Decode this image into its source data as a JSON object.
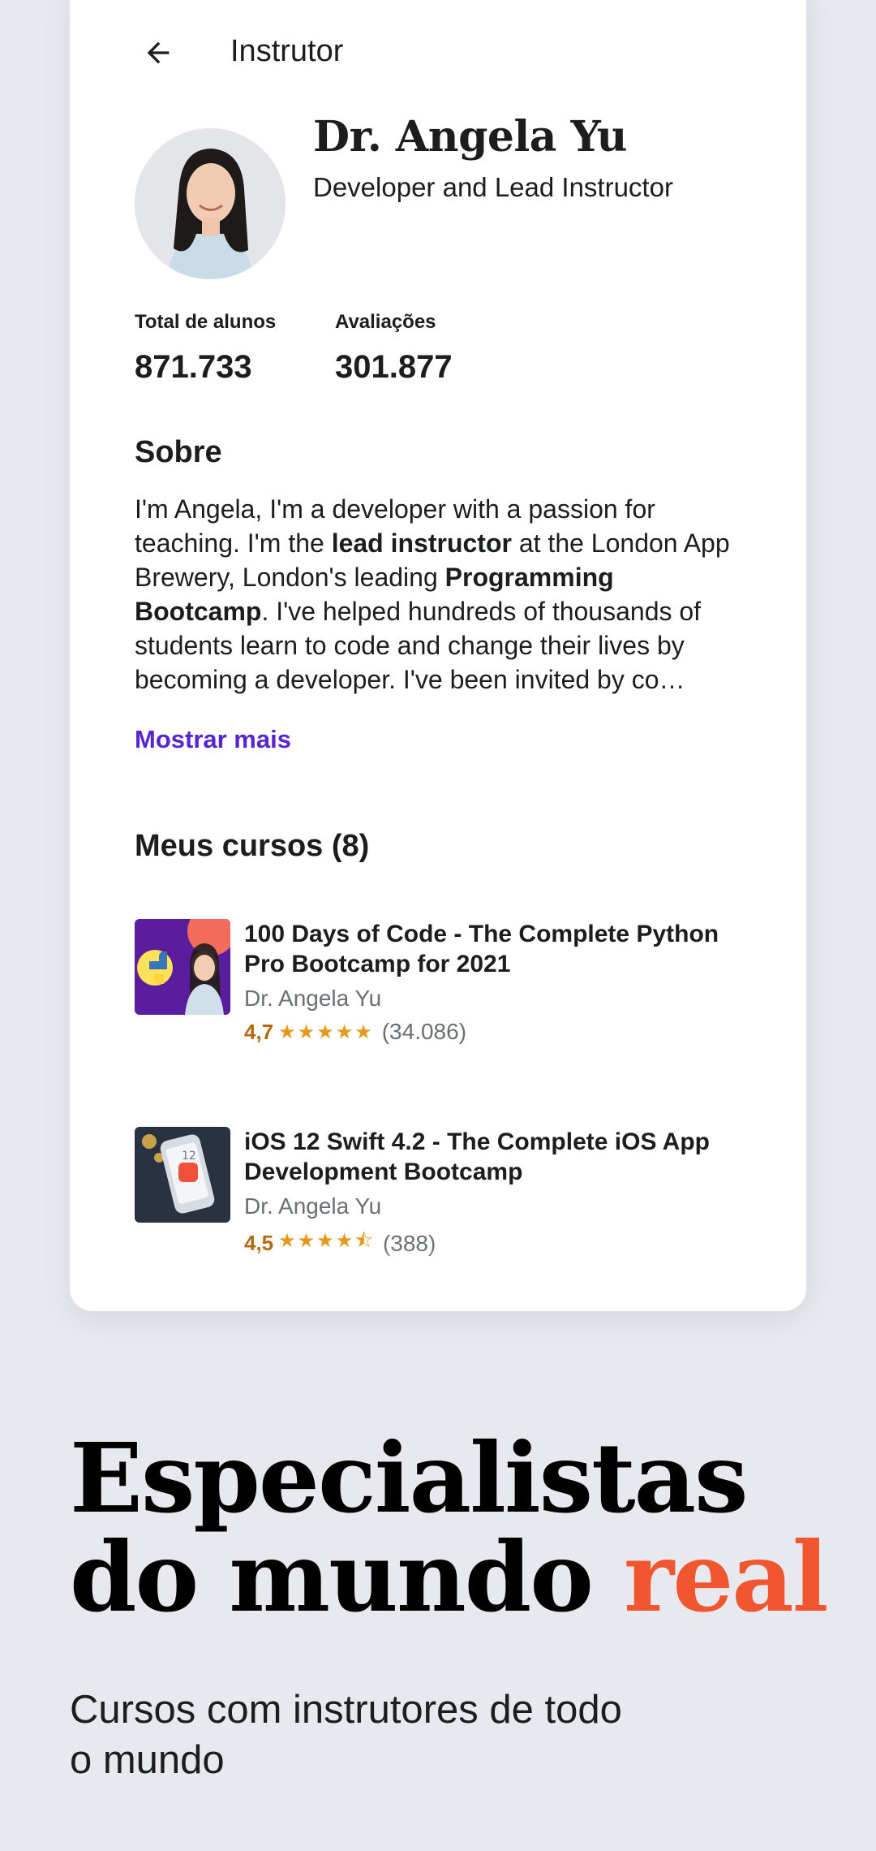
{
  "header": {
    "title": "Instrutor"
  },
  "instructor": {
    "name": "Dr. Angela Yu",
    "job_title": "Developer and Lead Instructor"
  },
  "stats": [
    {
      "label": "Total de alunos",
      "value": "871.733"
    },
    {
      "label": "Avaliações",
      "value": "301.877"
    }
  ],
  "about": {
    "title": "Sobre",
    "p1": "I'm Angela, I'm a developer with a passion for teaching. I'm the ",
    "b1": "lead instructor",
    "p2": " at the London App Brewery, London's leading ",
    "b2": "Programming Bootcamp",
    "p3": ". I've helped hundreds of thousands of students learn to code and change their lives by becoming a developer. I've been invited by co…",
    "show_more": "Mostrar mais"
  },
  "courses": {
    "title": "Meus cursos (8)",
    "items": [
      {
        "title": "100 Days of Code - The Complete Python Pro Bootcamp for 2021",
        "author": "Dr. Angela Yu",
        "rating": "4,7",
        "stars": "★★★★★",
        "count": "(34.086)"
      },
      {
        "title": "iOS 12 Swift 4.2 - The Complete iOS App Development Bootcamp",
        "author": "Dr. Angela Yu",
        "rating": "4,5",
        "stars": "★★★★⯪",
        "count": "(388)"
      }
    ]
  },
  "hero": {
    "line1": "Especialistas",
    "line2a": "do mundo ",
    "line2b": "real",
    "subtitle": "Cursos com instrutores de todo o mundo"
  },
  "colors": {
    "accent": "#f05630",
    "link": "#5624d0",
    "rating": "#b4690e",
    "star": "#e59819"
  }
}
